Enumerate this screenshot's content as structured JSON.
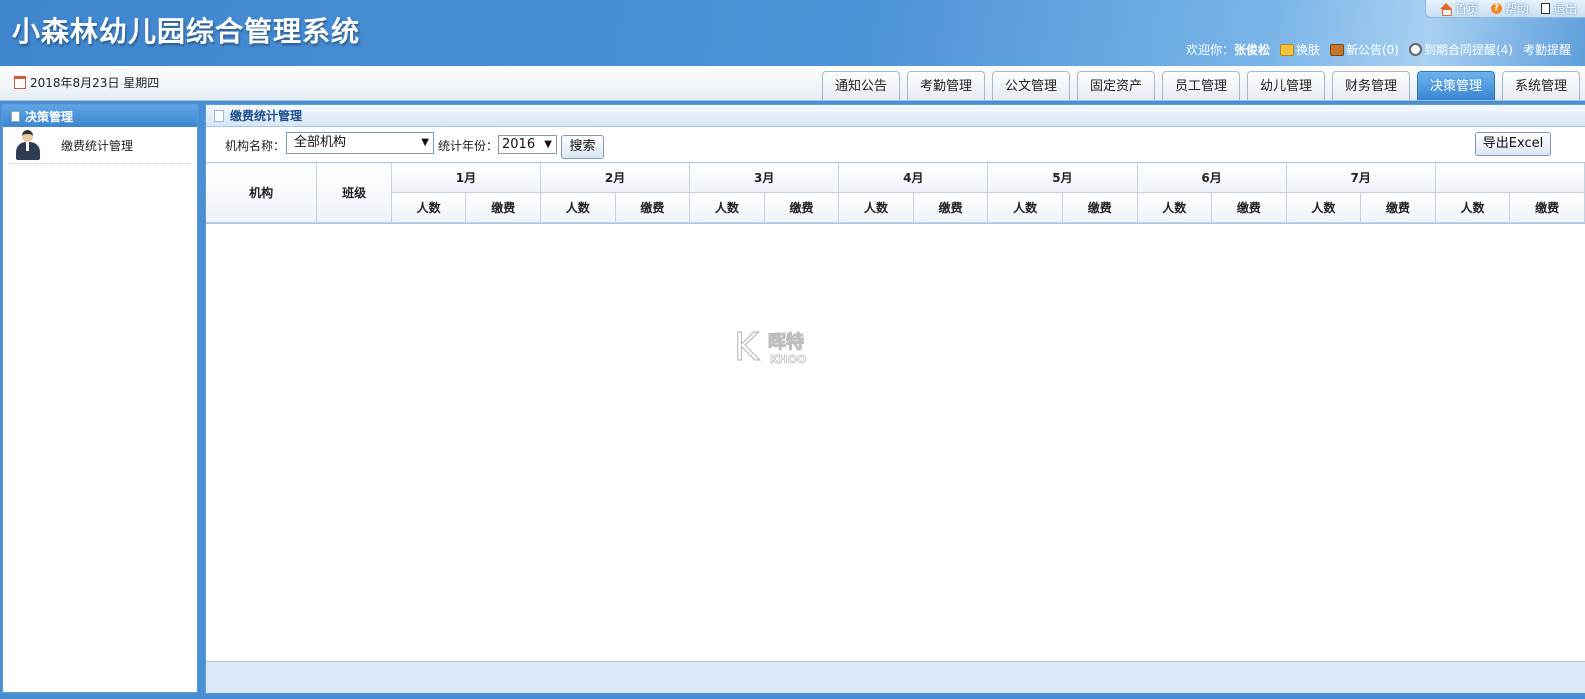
{
  "app": {
    "title": "小森林幼儿园综合管理系统"
  },
  "top_links": [
    {
      "label": "首页",
      "icon": "home-icon"
    },
    {
      "label": "帮助",
      "icon": "help-icon"
    },
    {
      "label": "退出",
      "icon": "exit-icon"
    }
  ],
  "welcome": {
    "prefix": "欢迎你：",
    "user": "张俊松",
    "skin": "换肤",
    "notice": "新公告(0)",
    "contract": "到期合同提醒(4)",
    "attendance": "考勤提醒"
  },
  "date": "2018年8月23日 星期四",
  "tabs": [
    "通知公告",
    "考勤管理",
    "公文管理",
    "固定资产",
    "员工管理",
    "幼儿管理",
    "财务管理",
    "决策管理",
    "系统管理"
  ],
  "active_tab": "决策管理",
  "sidebar": {
    "title": "决策管理",
    "items": [
      {
        "label": "缴费统计管理"
      }
    ]
  },
  "main": {
    "title": "缴费统计管理",
    "filters": {
      "org_label": "机构名称：",
      "org_value": "全部机构",
      "year_label": "统计年份：",
      "year_value": "2016",
      "search_label": "搜索",
      "export_label": "导出Excel"
    },
    "table": {
      "col_org": "机构",
      "col_class": "班级",
      "months": [
        "1月",
        "2月",
        "3月",
        "4月",
        "5月",
        "6月",
        "7月",
        ""
      ],
      "sub_count": "人数",
      "sub_fee": "缴费"
    }
  },
  "watermark": {
    "big": "K",
    "text1": "晖特",
    "text2": "KHOO"
  },
  "colors": {
    "header_blue": "#4a8fd4",
    "active_tab": "#3a86d4"
  }
}
